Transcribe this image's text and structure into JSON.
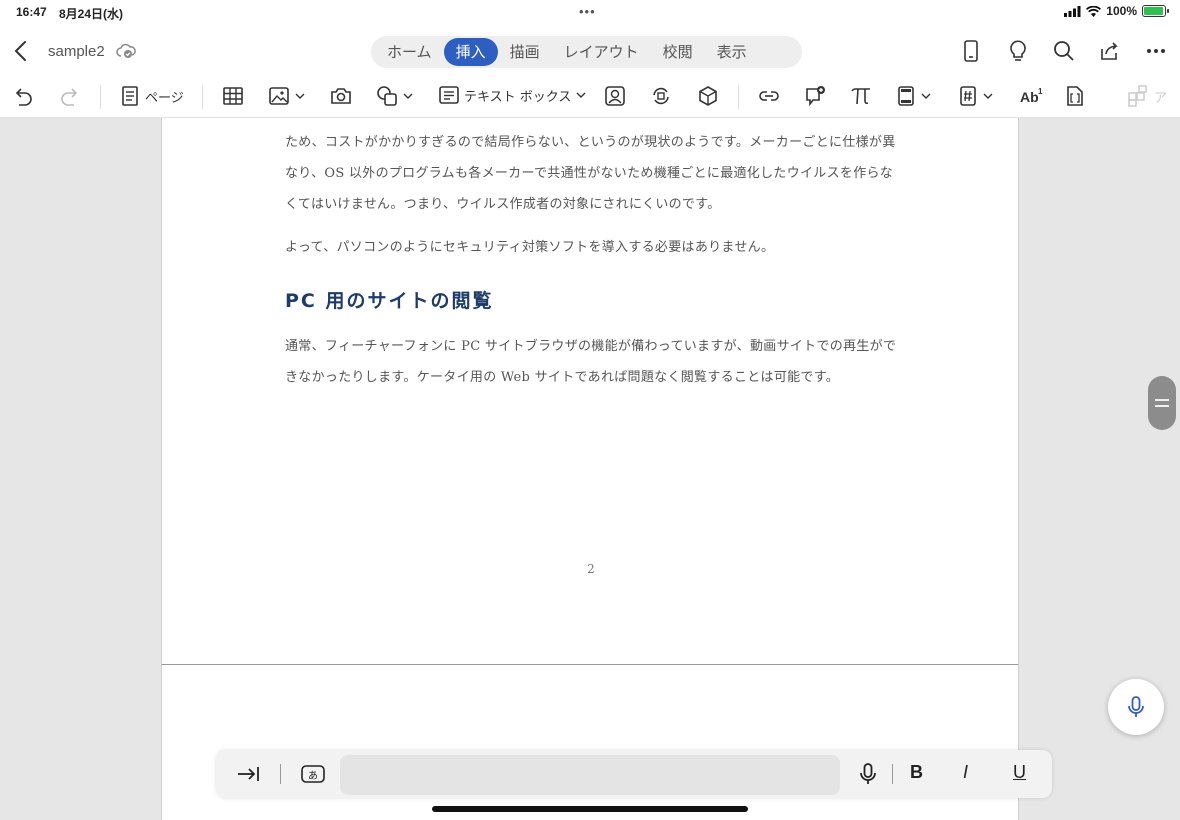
{
  "status_bar": {
    "time": "16:47",
    "date": "8月24日(水)",
    "battery": "100%",
    "battery_level": 1.0
  },
  "title_bar": {
    "document_name": "sample2",
    "tabs": [
      {
        "label": "ホーム",
        "active": false
      },
      {
        "label": "挿入",
        "active": true
      },
      {
        "label": "描画",
        "active": false
      },
      {
        "label": "レイアウト",
        "active": false
      },
      {
        "label": "校閲",
        "active": false
      },
      {
        "label": "表示",
        "active": false
      }
    ],
    "right_icons": [
      "phone-view-icon",
      "lightbulb-icon",
      "search-icon",
      "share-icon",
      "more-icon"
    ]
  },
  "ribbon": {
    "page_label": "ページ",
    "textbox_label": "テキスト ボックス",
    "add_in_label": "ア"
  },
  "document": {
    "paragraph1": "ため、コストがかかりすぎるので結局作らない、というのが現状のようです。メーカーごとに仕様が異なり、OS 以外のプログラムも各メーカーで共通性がないため機種ごとに最適化したウイルスを作らなくてはいけません。つまり、ウイルス作成者の対象にされにくいのです。",
    "paragraph2": "よって、パソコンのようにセキュリティ対策ソフトを導入する必要はありません。",
    "heading": "PC 用のサイトの閲覧",
    "paragraph3": "通常、フィーチャーフォンに PC サイトブラウザの機能が備わっていますが、動画サイトでの再生ができなかったりします。ケータイ用の Web サイトであれば問題なく閲覧することは可能です。",
    "page_number": "2"
  },
  "bottom_toolbar": {
    "bold": "B",
    "italic": "I",
    "underline": "U"
  },
  "colors": {
    "accent": "#2e5ebf",
    "heading": "#1f3b6a",
    "mic": "#2e5ebf"
  }
}
